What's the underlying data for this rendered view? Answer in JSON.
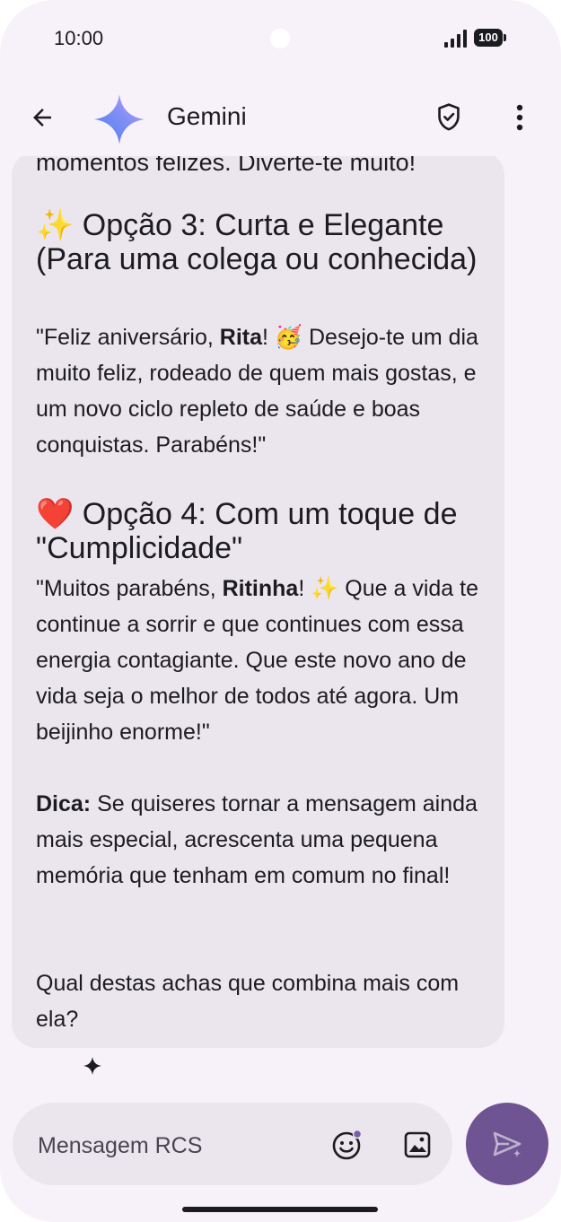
{
  "status_bar": {
    "time": "10:00",
    "battery": "100"
  },
  "app_bar": {
    "title": "Gemini"
  },
  "chat": {
    "cut_off_text": "momentos felizes. Diverte-te muito!",
    "option3": {
      "heading_emoji": "✨",
      "heading": "Opção 3: Curta e Elegante (Para uma colega ou conhecida)",
      "text_before": "\"Feliz aniversário, ",
      "name": "Rita",
      "text_after": "! 🥳 Desejo-te um dia muito feliz, rodeado de quem mais gostas, e um novo ciclo repleto de saúde e boas conquistas. Parabéns!\""
    },
    "option4": {
      "heading_emoji": "❤️",
      "heading": "Opção 4: Com um toque de \"Cumplicidade\"",
      "text_before": "\"Muitos parabéns, ",
      "name": "Ritinha",
      "text_after": "! ✨ Que a vida te continue a sorrir e que continues com essa energia contagiante. Que este novo ano de vida seja o melhor de todos até agora. Um beijinho enorme!\""
    },
    "tip": {
      "label": "Dica:",
      "text": " Se quiseres tornar a mensagem ainda mais especial, acrescenta uma pequena memória que tenham em comum no final!"
    },
    "question": "Qual destas achas que combina mais com ela?"
  },
  "composer": {
    "placeholder": "Mensagem RCS"
  },
  "colors": {
    "accent": "#6f5493",
    "bubble": "#ebe6ee",
    "background": "#f7f2fa",
    "heart": "#d93025",
    "sparkle": "#f5c518"
  },
  "icons": [
    "back-arrow-icon",
    "gemini-sparkle-icon",
    "shield-check-icon",
    "more-vert-icon",
    "sparkle-icon",
    "emoji-icon",
    "image-icon",
    "send-icon"
  ]
}
